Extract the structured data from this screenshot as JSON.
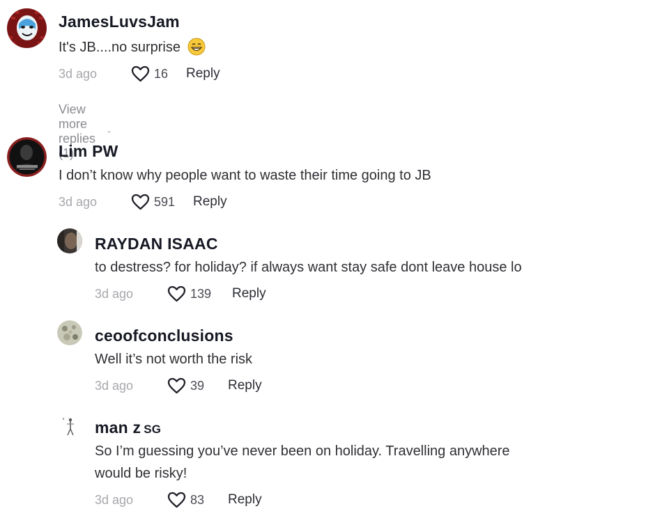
{
  "comments": [
    {
      "username": "JamesLuvsJam",
      "text": "It's JB....no surprise",
      "emoji": "grinning-emoji",
      "time": "3d ago",
      "likes": "16",
      "reply_label": "Reply",
      "view_more": "View more replies (1)"
    },
    {
      "username": "Lim PW",
      "text": "I don’t know why people want to waste their time going to JB",
      "time": "3d ago",
      "likes": "591",
      "reply_label": "Reply",
      "replies": [
        {
          "username": "RAYDAN ISAAC",
          "text": "to destress? for holiday? if always want stay safe dont leave house lo",
          "time": "3d ago",
          "likes": "139",
          "reply_label": "Reply"
        },
        {
          "username": "ceoofconclusions",
          "text": "Well it’s not worth the risk",
          "time": "3d ago",
          "likes": "39",
          "reply_label": "Reply"
        },
        {
          "username": "man z",
          "username_tag": "SG",
          "text_line1": "So I’m guessing you’ve never been on holiday. Travelling anywhere",
          "text_line2": "would be risky!",
          "time": "3d ago",
          "likes": "83",
          "reply_label": "Reply"
        }
      ]
    }
  ]
}
